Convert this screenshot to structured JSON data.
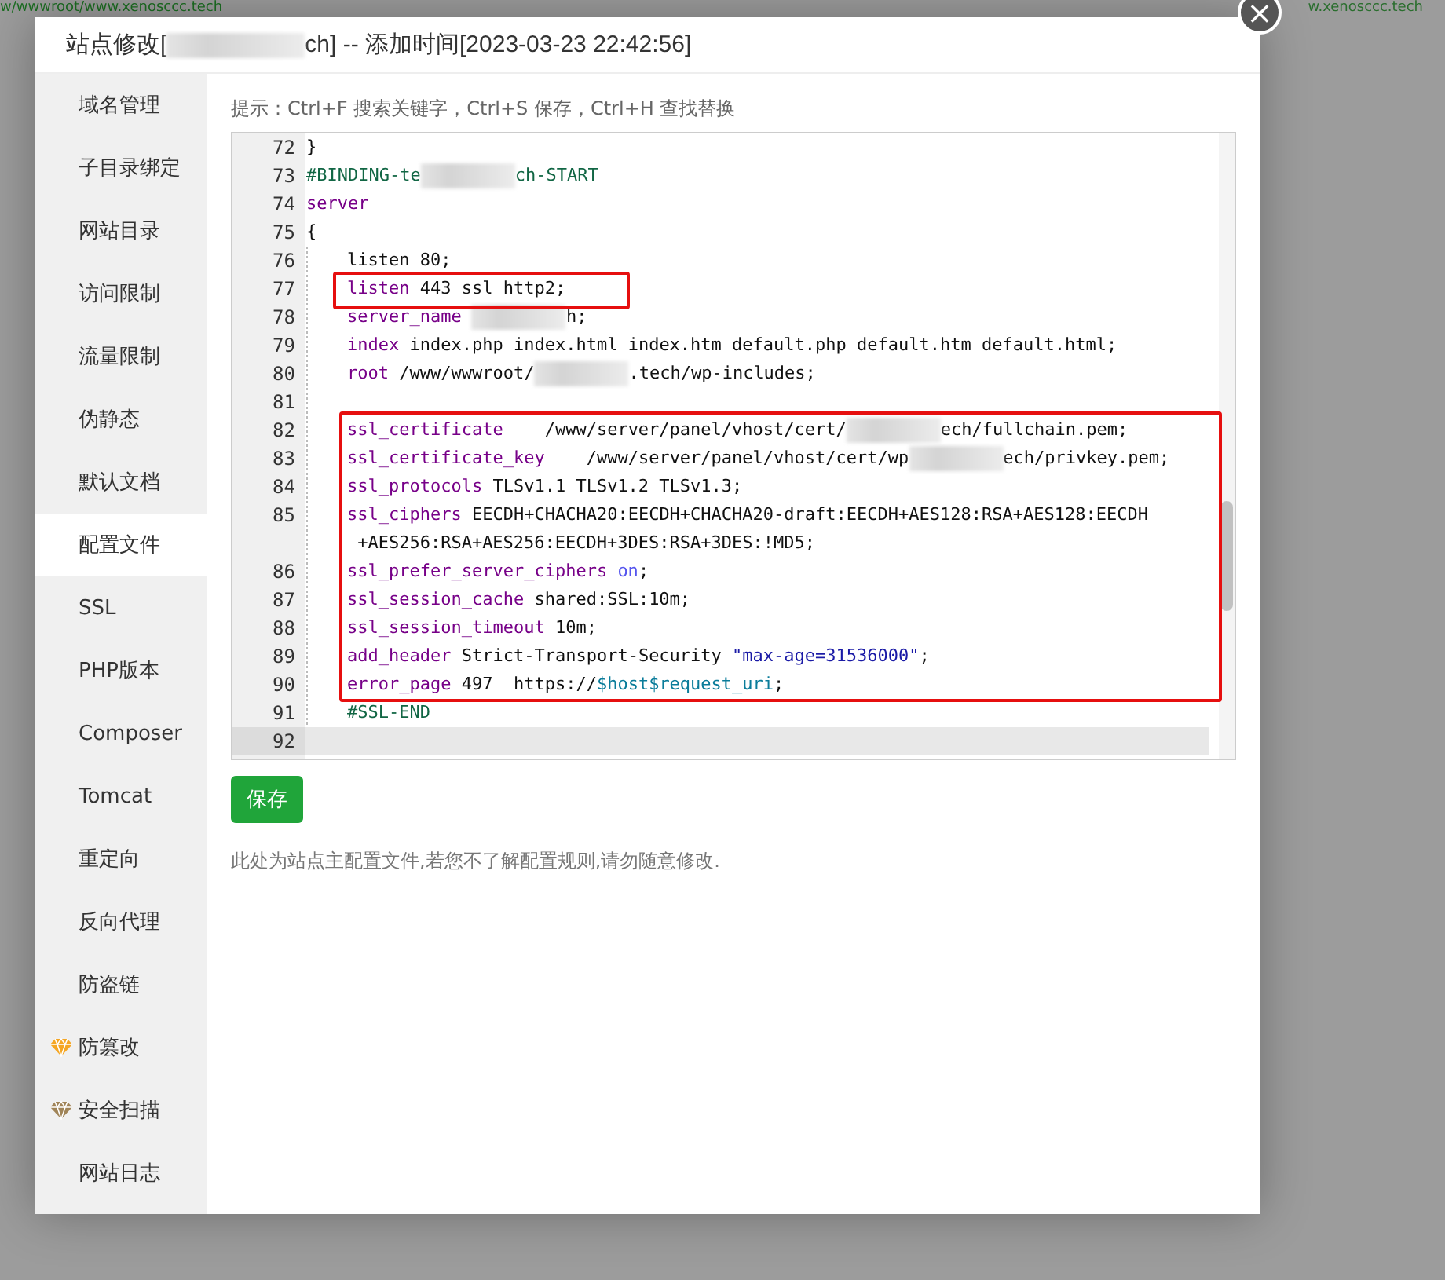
{
  "background_page": {
    "path": "w/wwwroot/www.xenosccc.tech",
    "domain": "w.xenosccc.tech"
  },
  "dialog": {
    "title_before": "站点修改[",
    "title_after": "ch] -- 添加时间[2023-03-23 22:42:56]",
    "close": "×"
  },
  "sidebar": {
    "items": [
      {
        "label": "域名管理",
        "selected": false
      },
      {
        "label": "子目录绑定",
        "selected": false
      },
      {
        "label": "网站目录",
        "selected": false
      },
      {
        "label": "访问限制",
        "selected": false
      },
      {
        "label": "流量限制",
        "selected": false
      },
      {
        "label": "伪静态",
        "selected": false
      },
      {
        "label": "默认文档",
        "selected": false
      },
      {
        "label": "配置文件",
        "selected": true
      },
      {
        "label": "SSL",
        "selected": false
      },
      {
        "label": "PHP版本",
        "selected": false
      },
      {
        "label": "Composer",
        "selected": false
      },
      {
        "label": "Tomcat",
        "selected": false
      },
      {
        "label": "重定向",
        "selected": false
      },
      {
        "label": "反向代理",
        "selected": false
      },
      {
        "label": "防盗链",
        "selected": false
      },
      {
        "label": "防篡改",
        "selected": false,
        "color": "#f5a623"
      },
      {
        "label": "安全扫描",
        "selected": false,
        "color": "#a08458"
      },
      {
        "label": "网站日志",
        "selected": false
      }
    ]
  },
  "hint": "提示：Ctrl+F 搜索关键字，Ctrl+S 保存，Ctrl+H 查找替换",
  "editor": {
    "lines": [
      {
        "number": "72",
        "indented": false,
        "selected": false,
        "tokens": [
          {
            "kind": "plain",
            "text": "}"
          }
        ]
      },
      {
        "number": "73",
        "indented": false,
        "selected": false,
        "tokens": [
          {
            "kind": "comment",
            "text": "#BINDING-te"
          },
          {
            "kind": "redacted"
          },
          {
            "kind": "comment",
            "text": "ch-START"
          }
        ]
      },
      {
        "number": "74",
        "indented": false,
        "selected": false,
        "tokens": [
          {
            "kind": "keyword",
            "text": "server"
          }
        ]
      },
      {
        "number": "75",
        "indented": false,
        "selected": false,
        "tokens": [
          {
            "kind": "plain",
            "text": "{"
          }
        ]
      },
      {
        "number": "76",
        "indented": true,
        "selected": false,
        "tokens": [
          {
            "kind": "plain",
            "text": "listen 80;"
          }
        ]
      },
      {
        "number": "77",
        "indented": true,
        "selected": false,
        "tokens": [
          {
            "kind": "keyword",
            "text": "listen"
          },
          {
            "kind": "plain",
            "text": " 443 ssl http2;"
          }
        ]
      },
      {
        "number": "78",
        "indented": true,
        "selected": false,
        "tokens": [
          {
            "kind": "keyword",
            "text": "server_name "
          },
          {
            "kind": "redacted"
          },
          {
            "kind": "plain",
            "text": "h;"
          }
        ]
      },
      {
        "number": "79",
        "indented": true,
        "selected": false,
        "tokens": [
          {
            "kind": "keyword",
            "text": "index"
          },
          {
            "kind": "plain",
            "text": " index.php index.html index.htm default.php default.htm default.html;"
          }
        ]
      },
      {
        "number": "80",
        "indented": true,
        "selected": false,
        "tokens": [
          {
            "kind": "keyword",
            "text": "root"
          },
          {
            "kind": "plain",
            "text": " /www/wwwroot/"
          },
          {
            "kind": "redacted"
          },
          {
            "kind": "plain",
            "text": ".tech/wp-includes;"
          }
        ]
      },
      {
        "number": "81",
        "indented": true,
        "selected": false
      },
      {
        "number": "82",
        "indented": true,
        "selected": false,
        "tokens": [
          {
            "kind": "keyword",
            "text": "ssl_certificate"
          },
          {
            "kind": "plain",
            "text": "    /www/server/panel/vhost/cert/"
          },
          {
            "kind": "redacted"
          },
          {
            "kind": "plain",
            "text": "ech/fullchain.pem;"
          }
        ]
      },
      {
        "number": "83",
        "indented": true,
        "selected": false,
        "tokens": [
          {
            "kind": "keyword",
            "text": "ssl_certificate_key"
          },
          {
            "kind": "plain",
            "text": "    /www/server/panel/vhost/cert/wp"
          },
          {
            "kind": "redacted"
          },
          {
            "kind": "plain",
            "text": "ech/privkey.pem;"
          }
        ]
      },
      {
        "number": "84",
        "indented": true,
        "selected": false,
        "tokens": [
          {
            "kind": "keyword",
            "text": "ssl_protocols"
          },
          {
            "kind": "plain",
            "text": " TLSv1.1 TLSv1.2 TLSv1.3;"
          }
        ]
      },
      {
        "number": "85",
        "indented": true,
        "selected": false,
        "tokens": [
          {
            "kind": "keyword",
            "text": "ssl_ciphers"
          },
          {
            "kind": "plain",
            "text": " EECDH+CHACHA20:EECDH+CHACHA20-draft:EECDH+AES128:RSA+AES128:EECDH"
          }
        ],
        "continued": [
          {
            "kind": "plain",
            "text": "+AES256:RSA+AES256:EECDH+3DES:RSA+3DES:!MD5;"
          }
        ]
      },
      {
        "number": "86",
        "indented": true,
        "selected": false,
        "tokens": [
          {
            "kind": "keyword",
            "text": "ssl_prefer_server_ciphers "
          },
          {
            "kind": "atom",
            "text": "on"
          },
          {
            "kind": "plain",
            "text": ";"
          }
        ]
      },
      {
        "number": "87",
        "indented": true,
        "selected": false,
        "tokens": [
          {
            "kind": "keyword",
            "text": "ssl_session_cache"
          },
          {
            "kind": "plain",
            "text": " shared:SSL:10m;"
          }
        ]
      },
      {
        "number": "88",
        "indented": true,
        "selected": false,
        "tokens": [
          {
            "kind": "keyword",
            "text": "ssl_session_timeout"
          },
          {
            "kind": "plain",
            "text": " 10m;"
          }
        ]
      },
      {
        "number": "89",
        "indented": true,
        "selected": false,
        "tokens": [
          {
            "kind": "keyword",
            "text": "add_header"
          },
          {
            "kind": "plain",
            "text": " Strict-Transport-Security "
          },
          {
            "kind": "string",
            "text": "\"max-age=31536000\""
          },
          {
            "kind": "plain",
            "text": ";"
          }
        ]
      },
      {
        "number": "90",
        "indented": true,
        "selected": false,
        "tokens": [
          {
            "kind": "keyword",
            "text": "error_page"
          },
          {
            "kind": "plain",
            "text": " 497  https://"
          },
          {
            "kind": "variable",
            "text": "$host$request_uri"
          },
          {
            "kind": "plain",
            "text": ";"
          }
        ]
      },
      {
        "number": "91",
        "indented": true,
        "selected": false,
        "tokens": [
          {
            "kind": "comment",
            "text": "#SSL-END"
          }
        ]
      },
      {
        "number": "92",
        "indented": false,
        "selected": true
      }
    ]
  },
  "save_button": "保存",
  "note": "此处为站点主配置文件,若您不了解配置规则,请勿随意修改."
}
